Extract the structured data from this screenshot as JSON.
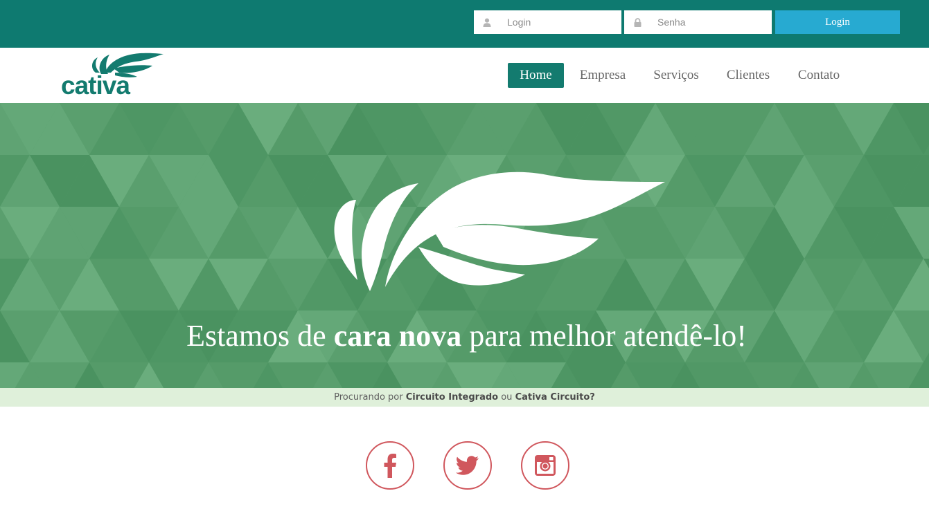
{
  "login_bar": {
    "login_placeholder": "Login",
    "password_placeholder": "Senha",
    "login_button": "Login",
    "user_icon": "user-icon",
    "lock_icon": "lock-icon"
  },
  "brand": {
    "logo_text": "cativa",
    "color": "#137b6f"
  },
  "nav": {
    "items": [
      {
        "label": "Home",
        "active": true
      },
      {
        "label": "Empresa",
        "active": false
      },
      {
        "label": "Serviços",
        "active": false
      },
      {
        "label": "Clientes",
        "active": false
      },
      {
        "label": "Contato",
        "active": false
      }
    ]
  },
  "hero": {
    "heading_before": "Estamos de ",
    "heading_bold": "cara nova",
    "heading_after": " para melhor atendê-lo!",
    "background_color": "#5a9f6e"
  },
  "search_strip": {
    "prefix": "Procurando por ",
    "term1": "Circuito Integrado",
    "connector": " ou ",
    "term2": "Cativa Circuito?"
  },
  "social": {
    "facebook_icon": "facebook-icon",
    "twitter_icon": "twitter-icon",
    "instagram_icon": "instagram-icon",
    "color": "#d0575d"
  },
  "colors": {
    "topbar": "#0e7a70",
    "accent_button": "#27aad1",
    "strip": "#dff0da"
  }
}
